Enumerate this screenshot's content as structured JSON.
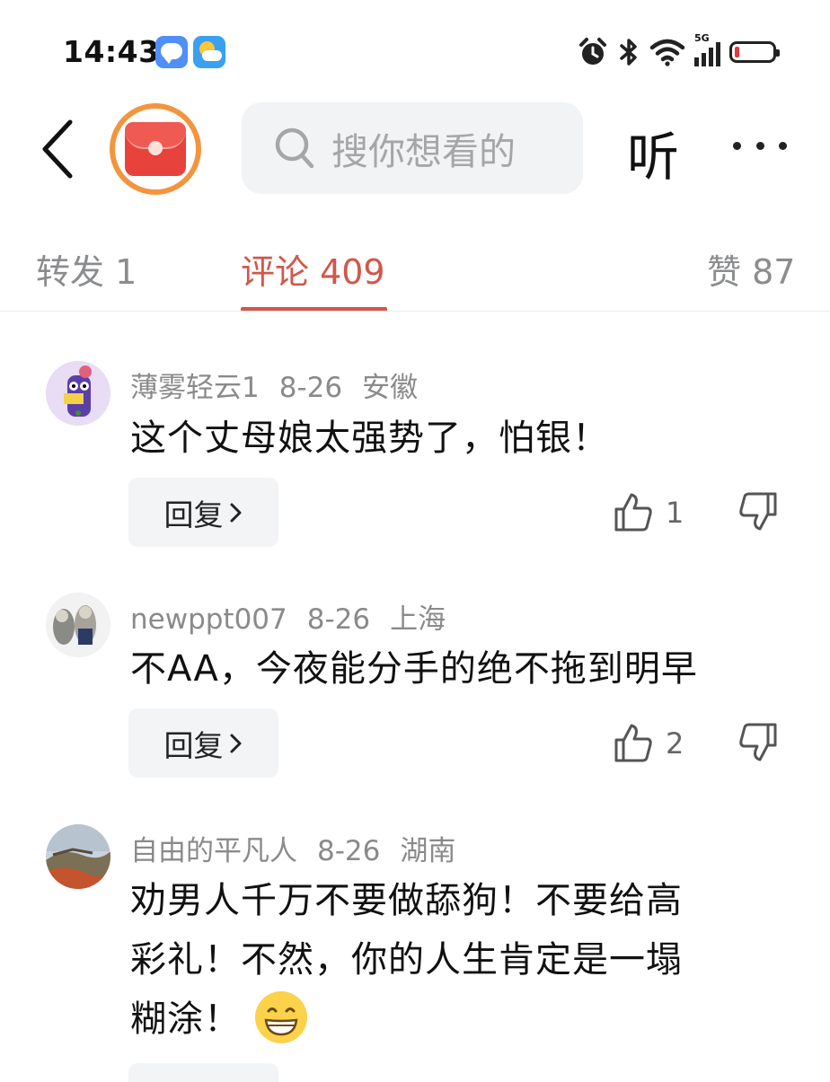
{
  "status_bar": {
    "time": "14:43",
    "network": "5G"
  },
  "nav": {
    "search_placeholder": "搜你想看的",
    "listen_label": "听"
  },
  "tabs": [
    {
      "label": "转发 1",
      "active": false
    },
    {
      "label": "评论 409",
      "active": true
    },
    {
      "label": "赞 87",
      "active": false
    }
  ],
  "comments": [
    {
      "user": "薄雾轻云1",
      "date": "8-26",
      "location": "安徽",
      "text": "这个丈母娘太强势了，怕银！",
      "reply_label": "回复",
      "likes": "1"
    },
    {
      "user": "newppt007",
      "date": "8-26",
      "location": "上海",
      "text": "不AA，今夜能分手的绝不拖到明早",
      "reply_label": "回复",
      "likes": "2"
    },
    {
      "user": "自由的平凡人",
      "date": "8-26",
      "location": "湖南",
      "text_line1": "劝男人千万不要做舔狗！不要给高",
      "text_line2": "彩礼！不然，你的人生肯定是一塌",
      "text_line3": "糊涂！"
    }
  ],
  "colors": {
    "accent": "#d1574b",
    "logo_ring": "#f2953e",
    "logo": "#e8423c"
  }
}
